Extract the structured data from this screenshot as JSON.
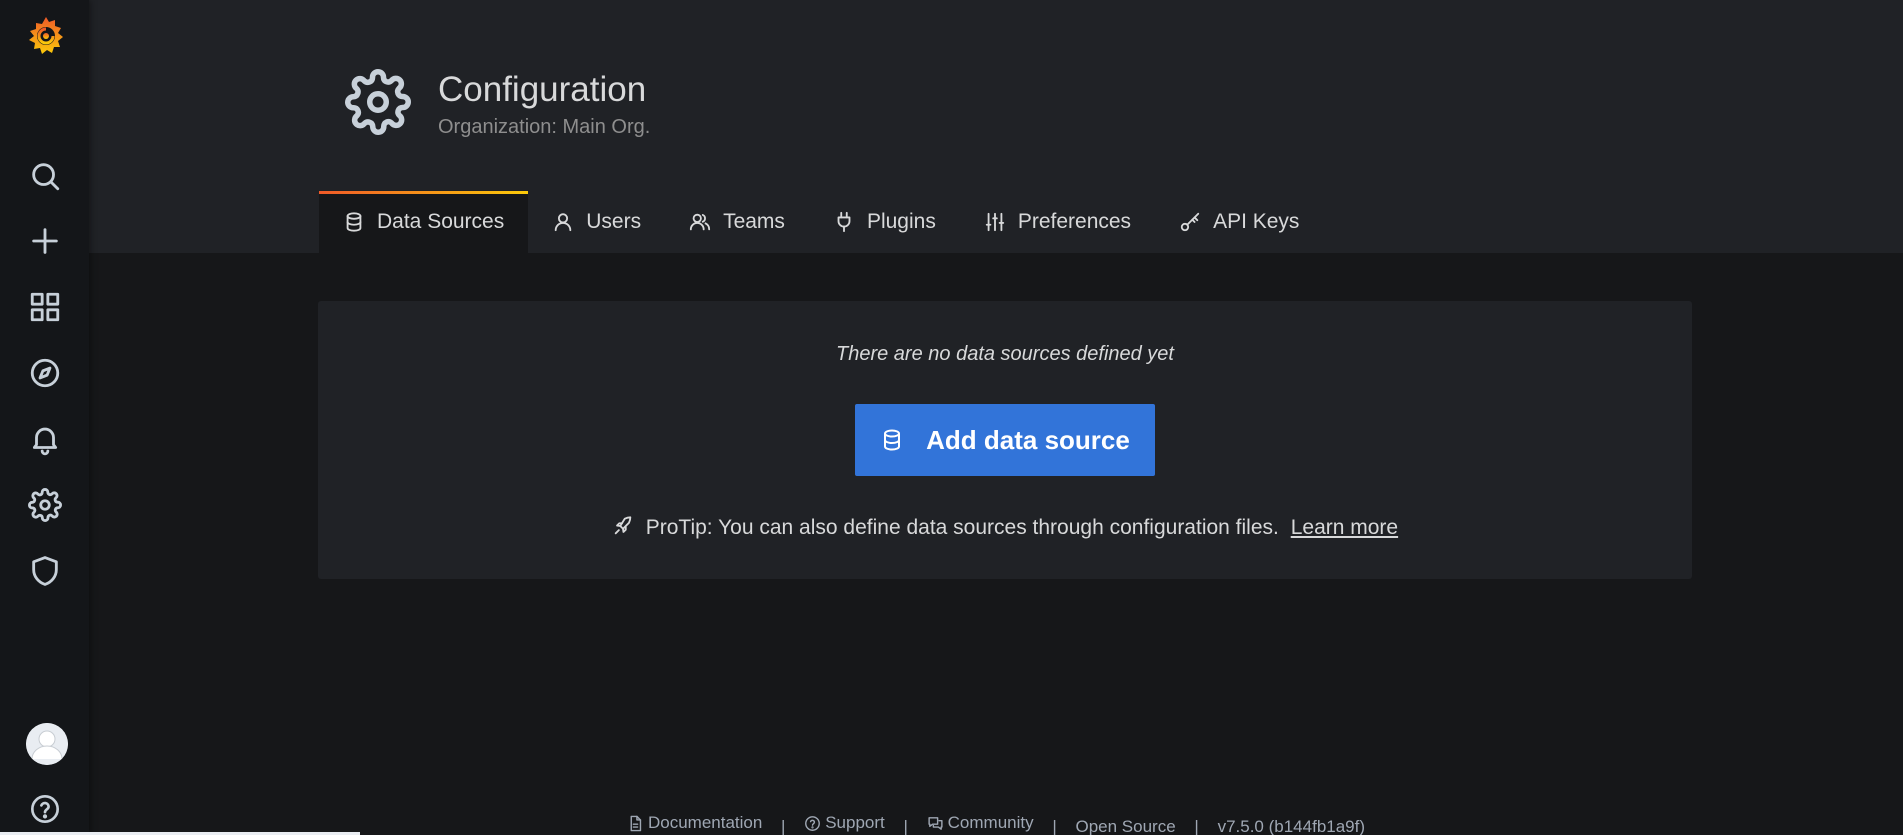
{
  "sidebar": {
    "logo": "grafana-logo",
    "items": [
      {
        "name": "search",
        "icon": "search-icon"
      },
      {
        "name": "create",
        "icon": "plus-icon"
      },
      {
        "name": "dashboards",
        "icon": "apps-icon"
      },
      {
        "name": "explore",
        "icon": "compass-icon"
      },
      {
        "name": "alerting",
        "icon": "bell-icon"
      },
      {
        "name": "configuration",
        "icon": "gear-icon"
      },
      {
        "name": "server-admin",
        "icon": "shield-icon"
      }
    ],
    "bottom": {
      "avatar": "avatar",
      "help": "question-circle-icon"
    }
  },
  "header": {
    "title": "Configuration",
    "subtitle": "Organization: Main Org.",
    "icon": "gear-icon"
  },
  "tabs": [
    {
      "label": "Data Sources",
      "icon": "database-icon",
      "active": true
    },
    {
      "label": "Users",
      "icon": "user-icon",
      "active": false
    },
    {
      "label": "Teams",
      "icon": "users-icon",
      "active": false
    },
    {
      "label": "Plugins",
      "icon": "plug-icon",
      "active": false
    },
    {
      "label": "Preferences",
      "icon": "sliders-icon",
      "active": false
    },
    {
      "label": "API Keys",
      "icon": "key-icon",
      "active": false
    }
  ],
  "main": {
    "empty_message": "There are no data sources defined yet",
    "add_button_label": "Add data source",
    "protip_text": "ProTip: You can also define data sources through configuration files.",
    "learn_more_label": "Learn more"
  },
  "footer": {
    "documentation": "Documentation",
    "support": "Support",
    "community": "Community",
    "open_source": "Open Source",
    "version": "v7.5.0 (b144fb1a9f)",
    "separator": "|"
  },
  "colors": {
    "accent_blue": "#3274d9",
    "tab_gradient_start": "#f05a28",
    "tab_gradient_end": "#fbca0a",
    "panel": "#202226",
    "background": "#161719"
  }
}
